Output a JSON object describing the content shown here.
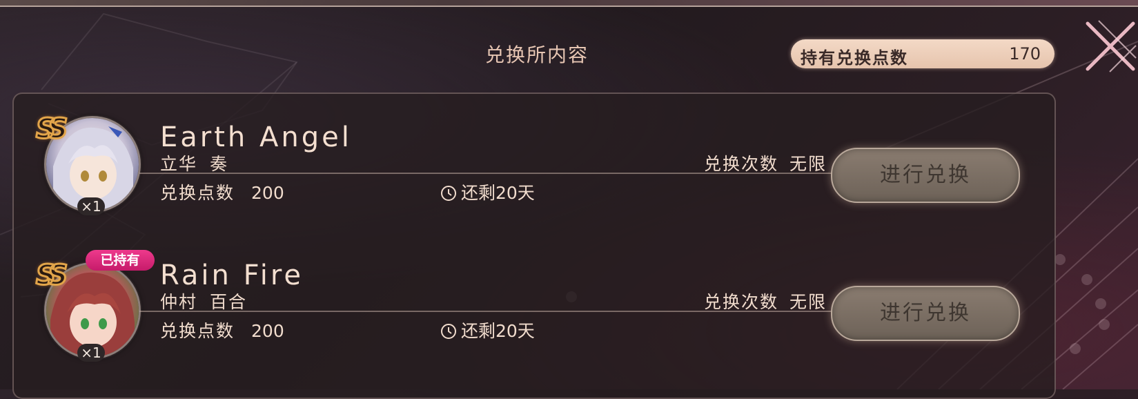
{
  "header": {
    "title": "兑换所内容",
    "points_label": "持有兑换点数",
    "points_value": "170"
  },
  "items": [
    {
      "rank": "SS",
      "song_title": "Earth Angel",
      "character": "立华 奏",
      "quantity": "×1",
      "cost_label": "兑换点数",
      "cost_value": "200",
      "time_left": "还剩20天",
      "limit": "兑换次数 无限",
      "button_label": "进行兑换",
      "owned": false
    },
    {
      "rank": "SS",
      "song_title": "Rain Fire",
      "character": "仲村 百合",
      "quantity": "×1",
      "cost_label": "兑换点数",
      "cost_value": "200",
      "time_left": "还剩20天",
      "limit": "兑换次数 无限",
      "button_label": "进行兑换",
      "owned": true,
      "owned_badge": "已持有"
    }
  ],
  "colors": {
    "accent_pill": "#f3d9c6",
    "owned_badge": "#e02a7c",
    "text": "#f1dccd",
    "rank_gold": "#e2a54a"
  }
}
